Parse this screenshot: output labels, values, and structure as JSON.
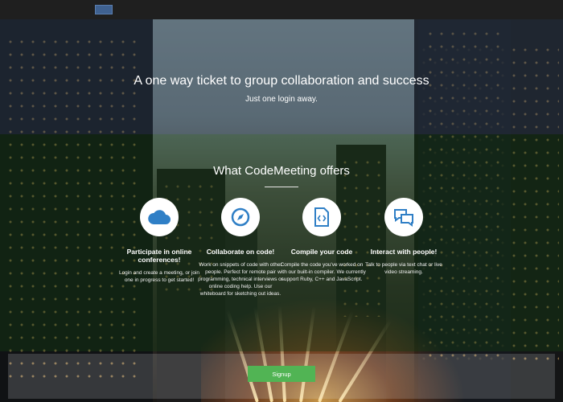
{
  "hero": {
    "title": "A one way ticket to group collaboration and success",
    "subtitle": "Just one login away."
  },
  "offers": {
    "title": "What CodeMeeting offers",
    "items": [
      {
        "icon": "cloud-icon",
        "title": "Participate in online conferences!",
        "text": "Login and create a meeting, or join one in progress to get started!"
      },
      {
        "icon": "compass-icon",
        "title": "Collaborate on code!",
        "text": "Work on snippets of code with other people. Perfect for remote pair programming, technical interviews or online coding help. Use our whiteboard for sketching out ideas."
      },
      {
        "icon": "code-file-icon",
        "title": "Compile your code",
        "text": "Compile the code you've worked on with our built-in compiler. We currently support Ruby, C++ and JavaScript."
      },
      {
        "icon": "chat-bubbles-icon",
        "title": "Interact with people!",
        "text": "Talk to people via text chat or live video streaming."
      }
    ]
  },
  "signup": {
    "label": "Signup"
  },
  "colors": {
    "icon_blue": "#2f7fc6",
    "signup_green": "#51b454",
    "topbar": "#1f1f1f"
  }
}
